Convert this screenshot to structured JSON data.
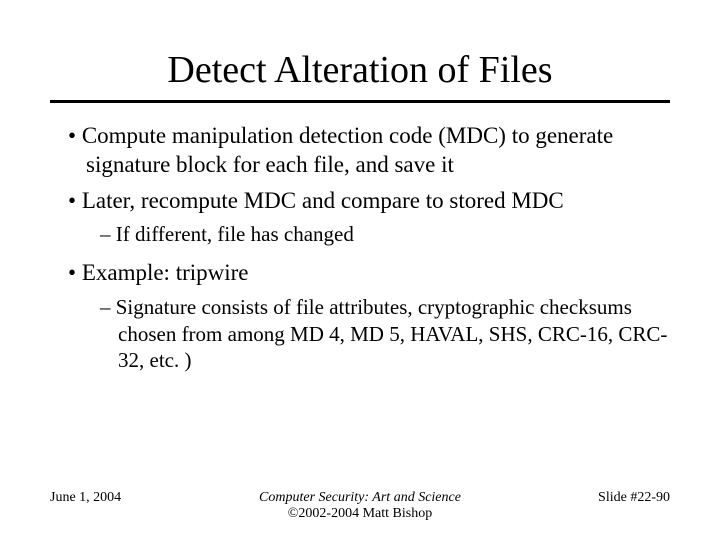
{
  "title": "Detect Alteration of Files",
  "bullets": {
    "b1": "Compute manipulation detection code (MDC) to generate signature block for each file, and save it",
    "b2": "Later, recompute MDC and compare to stored MDC",
    "b2_1": "If different, file has changed",
    "b3": "Example: tripwire",
    "b3_1": "Signature consists of file attributes, cryptographic checksums chosen from among MD 4, MD 5, HAVAL, SHS, CRC-16, CRC-32, etc. )"
  },
  "footer": {
    "date": "June 1, 2004",
    "book": "Computer Security: Art and Science",
    "copyright": "©2002-2004 Matt Bishop",
    "slide": "Slide #22-90"
  }
}
